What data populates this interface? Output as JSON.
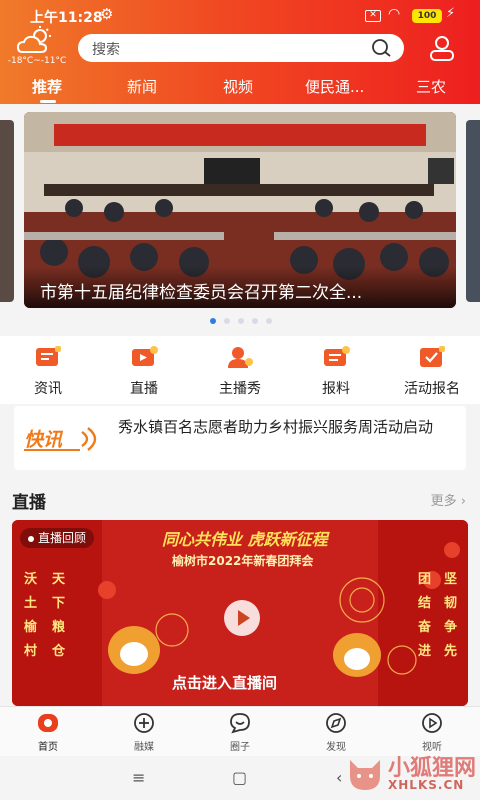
{
  "status_bar": {
    "time": "上午11:28",
    "battery": "100"
  },
  "weather": {
    "temp": "-18°C~-11°C"
  },
  "search": {
    "placeholder": "搜索"
  },
  "tabs": [
    {
      "label": "推荐",
      "active": true
    },
    {
      "label": "新闻"
    },
    {
      "label": "视频"
    },
    {
      "label": "便民通..."
    },
    {
      "label": "三农"
    }
  ],
  "banner": {
    "title": "市第十五届纪律检查委员会召开第二次全...",
    "slides": 5,
    "active_slide": 1
  },
  "quick_links": [
    {
      "label": "资讯",
      "icon": "news-icon"
    },
    {
      "label": "直播",
      "icon": "live-icon"
    },
    {
      "label": "主播秀",
      "icon": "anchor-icon"
    },
    {
      "label": "报料",
      "icon": "report-icon"
    },
    {
      "label": "活动报名",
      "icon": "signup-icon"
    }
  ],
  "flash_news": {
    "logo": "快讯",
    "text": "秀水镇百名志愿者助力乡村振兴服务周活动启动"
  },
  "live_section": {
    "title": "直播",
    "more": "更多 ›",
    "badge": "直播回顾",
    "poster_title": "同心共伟业 虎跃新征程",
    "poster_subtitle": "榆树市2022年新春团拜会",
    "left_couplet": [
      "沃土榆村",
      "天下粮仓"
    ],
    "right_couplet": [
      "团结奋进",
      "坚韧争先"
    ],
    "cta": "点击进入直播间"
  },
  "bottom_nav": [
    {
      "label": "首页",
      "icon": "home-icon",
      "active": true
    },
    {
      "label": "融媒",
      "icon": "media-icon"
    },
    {
      "label": "圈子",
      "icon": "circle-icon"
    },
    {
      "label": "发现",
      "icon": "discover-icon"
    },
    {
      "label": "视听",
      "icon": "video-icon"
    }
  ],
  "watermark": {
    "name": "小狐狸网",
    "domain": "XHLKS.CN"
  },
  "colors": {
    "brand": "#ee1f1f",
    "accent": "#f07a2a",
    "dot_active": "#2f7ae5"
  }
}
